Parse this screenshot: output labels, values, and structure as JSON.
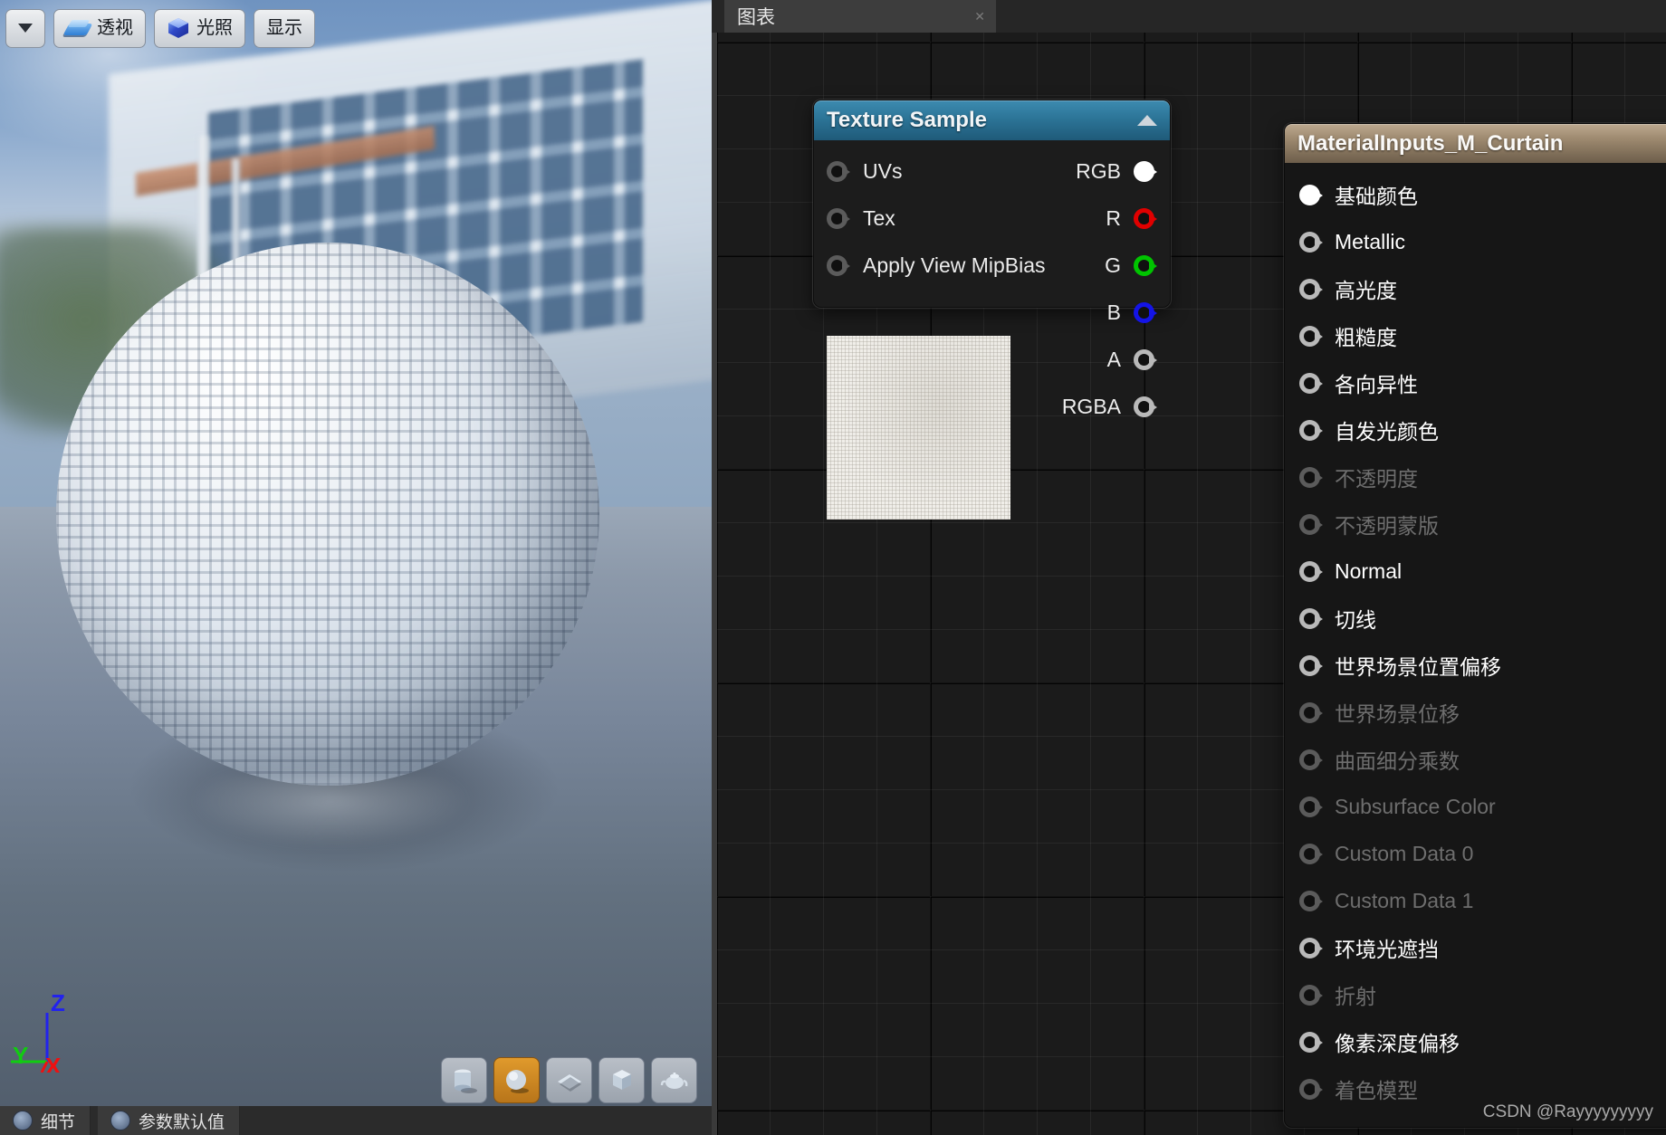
{
  "viewport": {
    "toolbar": [
      {
        "name": "view-options-dropdown",
        "icon": "chevron-down-icon",
        "label": ""
      },
      {
        "name": "perspective-button",
        "icon": "perspective-icon",
        "label": "透视"
      },
      {
        "name": "lit-button",
        "icon": "lit-cube-icon",
        "label": "光照"
      },
      {
        "name": "show-button",
        "icon": "",
        "label": "显示"
      }
    ],
    "axis": {
      "x": "X",
      "y": "Y",
      "z": "Z"
    },
    "shapes": [
      {
        "name": "primitive-cylinder",
        "icon": "cylinder-icon",
        "active": false
      },
      {
        "name": "primitive-sphere",
        "icon": "sphere-icon",
        "active": true
      },
      {
        "name": "primitive-plane",
        "icon": "plane-icon",
        "active": false
      },
      {
        "name": "primitive-cube",
        "icon": "cube-icon",
        "active": false
      },
      {
        "name": "primitive-teapot",
        "icon": "teapot-icon",
        "active": false
      }
    ],
    "bottom_tabs": [
      {
        "name": "tab-details",
        "label": "细节"
      },
      {
        "name": "tab-parameter-defaults",
        "label": "参数默认值"
      }
    ]
  },
  "graph": {
    "tab": {
      "label": "图表",
      "close": "✕"
    },
    "texture_sample_node": {
      "title": "Texture Sample",
      "collapse_icon": "triangle-up-icon",
      "inputs": [
        {
          "label": "UVs",
          "state": "empty"
        },
        {
          "label": "Tex",
          "state": "empty"
        },
        {
          "label": "Apply View MipBias",
          "state": "empty"
        }
      ],
      "outputs": [
        {
          "label": "RGB",
          "state": "connected",
          "color": "#ffffff"
        },
        {
          "label": "R",
          "state": "empty",
          "color": "#e00000"
        },
        {
          "label": "G",
          "state": "empty",
          "color": "#00c400"
        },
        {
          "label": "B",
          "state": "empty",
          "color": "#1414e6"
        },
        {
          "label": "A",
          "state": "empty",
          "color": "#b9b9b9"
        },
        {
          "label": "RGBA",
          "state": "empty",
          "color": "#b9b9b9"
        }
      ]
    },
    "material_node": {
      "title": "MaterialInputs_M_Curtain",
      "inputs": [
        {
          "label": "基础颜色",
          "enabled": true,
          "connected": true
        },
        {
          "label": "Metallic",
          "enabled": true,
          "connected": false
        },
        {
          "label": "高光度",
          "enabled": true,
          "connected": false
        },
        {
          "label": "粗糙度",
          "enabled": true,
          "connected": false
        },
        {
          "label": "各向异性",
          "enabled": true,
          "connected": false
        },
        {
          "label": "自发光颜色",
          "enabled": true,
          "connected": false
        },
        {
          "label": "不透明度",
          "enabled": false,
          "connected": false
        },
        {
          "label": "不透明蒙版",
          "enabled": false,
          "connected": false
        },
        {
          "label": "Normal",
          "enabled": true,
          "connected": false
        },
        {
          "label": "切线",
          "enabled": true,
          "connected": false
        },
        {
          "label": "世界场景位置偏移",
          "enabled": true,
          "connected": false
        },
        {
          "label": "世界场景位移",
          "enabled": false,
          "connected": false
        },
        {
          "label": "曲面细分乘数",
          "enabled": false,
          "connected": false
        },
        {
          "label": "Subsurface Color",
          "enabled": false,
          "connected": false
        },
        {
          "label": "Custom Data 0",
          "enabled": false,
          "connected": false
        },
        {
          "label": "Custom Data 1",
          "enabled": false,
          "connected": false
        },
        {
          "label": "环境光遮挡",
          "enabled": true,
          "connected": false
        },
        {
          "label": "折射",
          "enabled": false,
          "connected": false
        },
        {
          "label": "像素深度偏移",
          "enabled": true,
          "connected": false
        },
        {
          "label": "着色模型",
          "enabled": false,
          "connected": false
        }
      ]
    }
  },
  "watermark": "CSDN @Rayyyyyyyyy",
  "colors": {
    "texture_node_header": "#2d7699",
    "material_node_header": "#9c886e",
    "accent_active": "#e09a2c",
    "graph_background": "#1b1b1b"
  }
}
